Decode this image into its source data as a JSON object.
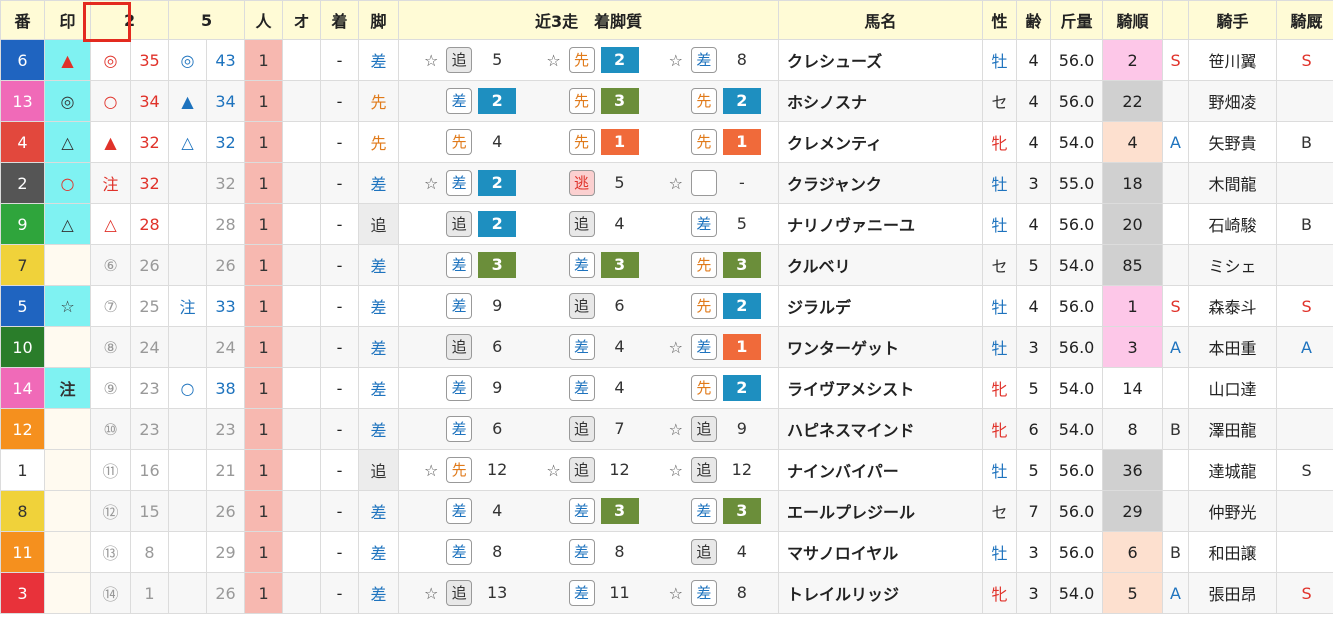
{
  "header": {
    "ban": "番",
    "in": "印",
    "c2": "2",
    "c5": "5",
    "ninki": "人",
    "o": "オ",
    "chaku": "着",
    "kyaku": "脚",
    "kin3": "近3走　着脚質",
    "bamei": "馬名",
    "sei": "性",
    "rei": "齢",
    "kinryo": "斤量",
    "kijun": "騎順",
    "kishu": "騎手",
    "kyusha": "騎厩"
  },
  "colors": {
    "waku": {
      "1": "#ffffff",
      "2": "#555555",
      "3": "#e8323a",
      "4": "#e2483d",
      "5": "#1f64c0",
      "6": "#1f64c0",
      "7": "#f0d23a",
      "8": "#f0d23a",
      "9": "#2fa53c",
      "10": "#2a7d2a",
      "11": "#f5901e",
      "12": "#f5901e",
      "13": "#f06ab8",
      "14": "#f06ab8"
    }
  },
  "rows": [
    {
      "num": "6",
      "numColor": "#1f64c0",
      "mark": "▲",
      "markClass": "mk-red",
      "markEmpty": false,
      "r2m": "◎",
      "r2mc": "red",
      "r2": "35",
      "r2c": "red",
      "r5m": "◎",
      "r5mc": "blue",
      "r5": "43",
      "r5c": "blue",
      "ninki": "1",
      "o": "",
      "chaku": "-",
      "kyaku": "差",
      "kyakuClass": "kyaku-sa",
      "races": [
        {
          "star": "☆",
          "tag": "追",
          "tagc": "tsui",
          "rk": "5",
          "rkc": "n"
        },
        {
          "star": "☆",
          "tag": "先",
          "tagc": "sen",
          "rk": "2",
          "rkc": "b"
        },
        {
          "star": "☆",
          "tag": "差",
          "tagc": "sa",
          "rk": "8",
          "rkc": "n"
        }
      ],
      "name": "クレシューズ",
      "sex": "牡",
      "sexClass": "sex-m",
      "age": "4",
      "kinryo": "56.0",
      "kijun": "2",
      "kijunClass": "kijun-1",
      "rank": "S",
      "rankc": "red",
      "jockey": "笹川翼",
      "stable": "S",
      "stablec": "red"
    },
    {
      "num": "13",
      "numColor": "#f06ab8",
      "mark": "◎",
      "markClass": "mk-dark",
      "markEmpty": false,
      "r2m": "○",
      "r2mc": "red",
      "r2": "34",
      "r2c": "red",
      "r5m": "▲",
      "r5mc": "blue",
      "r5": "34",
      "r5c": "blue",
      "ninki": "1",
      "o": "",
      "chaku": "-",
      "kyaku": "先",
      "kyakuClass": "kyaku-sen",
      "races": [
        {
          "star": "",
          "tag": "差",
          "tagc": "sa",
          "rk": "2",
          "rkc": "b"
        },
        {
          "star": "",
          "tag": "先",
          "tagc": "sen",
          "rk": "3",
          "rkc": "g"
        },
        {
          "star": "",
          "tag": "先",
          "tagc": "sen",
          "rk": "2",
          "rkc": "b"
        }
      ],
      "name": "ホシノスナ",
      "sex": "セ",
      "sexClass": "sex-g",
      "age": "4",
      "kinryo": "56.0",
      "kijun": "22",
      "kijunClass": "kijun-3",
      "rank": "",
      "rankc": "red",
      "jockey": "野畑凌",
      "stable": "",
      "stablec": "red"
    },
    {
      "num": "4",
      "numColor": "#e2483d",
      "mark": "△",
      "markClass": "mk-dark",
      "markEmpty": false,
      "r2m": "▲",
      "r2mc": "red",
      "r2": "32",
      "r2c": "red",
      "r5m": "△",
      "r5mc": "blue",
      "r5": "32",
      "r5c": "blue",
      "ninki": "1",
      "o": "",
      "chaku": "-",
      "kyaku": "先",
      "kyakuClass": "kyaku-sen",
      "races": [
        {
          "star": "",
          "tag": "先",
          "tagc": "sen",
          "rk": "4",
          "rkc": "n"
        },
        {
          "star": "",
          "tag": "先",
          "tagc": "sen",
          "rk": "1",
          "rkc": "r"
        },
        {
          "star": "",
          "tag": "先",
          "tagc": "sen",
          "rk": "1",
          "rkc": "r"
        }
      ],
      "name": "クレメンティ",
      "sex": "牝",
      "sexClass": "sex-f",
      "age": "4",
      "kinryo": "54.0",
      "kijun": "4",
      "kijunClass": "kijun-2",
      "rank": "A",
      "rankc": "blue",
      "jockey": "矢野貴",
      "stable": "B",
      "stablec": "dark"
    },
    {
      "num": "2",
      "numColor": "#555555",
      "mark": "○",
      "markClass": "mk-red",
      "markEmpty": false,
      "r2m": "注",
      "r2mc": "red",
      "r2": "32",
      "r2c": "red",
      "r5m": "",
      "r5mc": "blue",
      "r5": "32",
      "r5c": "gray",
      "ninki": "1",
      "o": "",
      "chaku": "-",
      "kyaku": "差",
      "kyakuClass": "kyaku-sa",
      "races": [
        {
          "star": "☆",
          "tag": "差",
          "tagc": "sa",
          "rk": "2",
          "rkc": "b"
        },
        {
          "star": "",
          "tag": "逃",
          "tagc": "nige",
          "rk": "5",
          "rkc": "n"
        },
        {
          "star": "☆",
          "tag": "",
          "tagc": "blank",
          "rk": "-",
          "rkc": "n"
        }
      ],
      "name": "クラジャンク",
      "sex": "牡",
      "sexClass": "sex-m",
      "age": "3",
      "kinryo": "55.0",
      "kijun": "18",
      "kijunClass": "kijun-3",
      "rank": "",
      "rankc": "red",
      "jockey": "木間龍",
      "stable": "",
      "stablec": "red"
    },
    {
      "num": "9",
      "numColor": "#2fa53c",
      "mark": "△",
      "markClass": "mk-dark",
      "markEmpty": false,
      "r2m": "△",
      "r2mc": "red",
      "r2": "28",
      "r2c": "red",
      "r5m": "",
      "r5mc": "blue",
      "r5": "28",
      "r5c": "gray",
      "ninki": "1",
      "o": "",
      "chaku": "-",
      "kyaku": "追",
      "kyakuClass": "kyaku-tsui",
      "races": [
        {
          "star": "",
          "tag": "追",
          "tagc": "tsui",
          "rk": "2",
          "rkc": "b"
        },
        {
          "star": "",
          "tag": "追",
          "tagc": "tsui",
          "rk": "4",
          "rkc": "n"
        },
        {
          "star": "",
          "tag": "差",
          "tagc": "sa",
          "rk": "5",
          "rkc": "n"
        }
      ],
      "name": "ナリノヴァニーユ",
      "sex": "牡",
      "sexClass": "sex-m",
      "age": "4",
      "kinryo": "56.0",
      "kijun": "20",
      "kijunClass": "kijun-3",
      "rank": "",
      "rankc": "red",
      "jockey": "石崎駿",
      "stable": "B",
      "stablec": "dark"
    },
    {
      "num": "7",
      "numColor": "#f0d23a",
      "mark": "",
      "markClass": "mk-dark",
      "markEmpty": true,
      "r2m": "⑥",
      "r2mc": "gray",
      "r2": "26",
      "r2c": "gray",
      "r5m": "",
      "r5mc": "blue",
      "r5": "26",
      "r5c": "gray",
      "ninki": "1",
      "o": "",
      "chaku": "-",
      "kyaku": "差",
      "kyakuClass": "kyaku-sa",
      "races": [
        {
          "star": "",
          "tag": "差",
          "tagc": "sa",
          "rk": "3",
          "rkc": "g"
        },
        {
          "star": "",
          "tag": "差",
          "tagc": "sa",
          "rk": "3",
          "rkc": "g"
        },
        {
          "star": "",
          "tag": "先",
          "tagc": "sen",
          "rk": "3",
          "rkc": "g"
        }
      ],
      "name": "クルベリ",
      "sex": "セ",
      "sexClass": "sex-g",
      "age": "5",
      "kinryo": "54.0",
      "kijun": "85",
      "kijunClass": "kijun-3",
      "rank": "",
      "rankc": "red",
      "jockey": "ミシェ",
      "stable": "",
      "stablec": "red"
    },
    {
      "num": "5",
      "numColor": "#1f64c0",
      "mark": "☆",
      "markClass": "mk-dark",
      "markEmpty": false,
      "r2m": "⑦",
      "r2mc": "gray",
      "r2": "25",
      "r2c": "gray",
      "r5m": "注",
      "r5mc": "blue",
      "r5": "33",
      "r5c": "blue",
      "ninki": "1",
      "o": "",
      "chaku": "-",
      "kyaku": "差",
      "kyakuClass": "kyaku-sa",
      "races": [
        {
          "star": "",
          "tag": "差",
          "tagc": "sa",
          "rk": "9",
          "rkc": "n"
        },
        {
          "star": "",
          "tag": "追",
          "tagc": "tsui",
          "rk": "6",
          "rkc": "n"
        },
        {
          "star": "",
          "tag": "先",
          "tagc": "sen",
          "rk": "2",
          "rkc": "b"
        }
      ],
      "name": "ジラルデ",
      "sex": "牡",
      "sexClass": "sex-m",
      "age": "4",
      "kinryo": "56.0",
      "kijun": "1",
      "kijunClass": "kijun-1",
      "rank": "S",
      "rankc": "red",
      "jockey": "森泰斗",
      "stable": "S",
      "stablec": "red"
    },
    {
      "num": "10",
      "numColor": "#2a7d2a",
      "mark": "",
      "markClass": "mk-dark",
      "markEmpty": true,
      "r2m": "⑧",
      "r2mc": "gray",
      "r2": "24",
      "r2c": "gray",
      "r5m": "",
      "r5mc": "blue",
      "r5": "24",
      "r5c": "gray",
      "ninki": "1",
      "o": "",
      "chaku": "-",
      "kyaku": "差",
      "kyakuClass": "kyaku-sa",
      "races": [
        {
          "star": "",
          "tag": "追",
          "tagc": "tsui",
          "rk": "6",
          "rkc": "n"
        },
        {
          "star": "",
          "tag": "差",
          "tagc": "sa",
          "rk": "4",
          "rkc": "n"
        },
        {
          "star": "☆",
          "tag": "差",
          "tagc": "sa",
          "rk": "1",
          "rkc": "r"
        }
      ],
      "name": "ワンターゲット",
      "sex": "牡",
      "sexClass": "sex-m",
      "age": "3",
      "kinryo": "56.0",
      "kijun": "3",
      "kijunClass": "kijun-1",
      "rank": "A",
      "rankc": "blue",
      "jockey": "本田重",
      "stable": "A",
      "stablec": "blue"
    },
    {
      "num": "14",
      "numColor": "#f06ab8",
      "mark": "注",
      "markClass": "mk-dark",
      "markEmpty": false,
      "r2m": "⑨",
      "r2mc": "gray",
      "r2": "23",
      "r2c": "gray",
      "r5m": "○",
      "r5mc": "blue",
      "r5": "38",
      "r5c": "blue",
      "ninki": "1",
      "o": "",
      "chaku": "-",
      "kyaku": "差",
      "kyakuClass": "kyaku-sa",
      "races": [
        {
          "star": "",
          "tag": "差",
          "tagc": "sa",
          "rk": "9",
          "rkc": "n"
        },
        {
          "star": "",
          "tag": "差",
          "tagc": "sa",
          "rk": "4",
          "rkc": "n"
        },
        {
          "star": "",
          "tag": "先",
          "tagc": "sen",
          "rk": "2",
          "rkc": "b"
        }
      ],
      "name": "ライヴアメシスト",
      "sex": "牝",
      "sexClass": "sex-f",
      "age": "5",
      "kinryo": "54.0",
      "kijun": "14",
      "kijunClass": "kijun-0",
      "rank": "",
      "rankc": "red",
      "jockey": "山口達",
      "stable": "",
      "stablec": "red"
    },
    {
      "num": "12",
      "numColor": "#f5901e",
      "mark": "",
      "markClass": "mk-dark",
      "markEmpty": true,
      "r2m": "⑩",
      "r2mc": "gray",
      "r2": "23",
      "r2c": "gray",
      "r5m": "",
      "r5mc": "blue",
      "r5": "23",
      "r5c": "gray",
      "ninki": "1",
      "o": "",
      "chaku": "-",
      "kyaku": "差",
      "kyakuClass": "kyaku-sa",
      "races": [
        {
          "star": "",
          "tag": "差",
          "tagc": "sa",
          "rk": "6",
          "rkc": "n"
        },
        {
          "star": "",
          "tag": "追",
          "tagc": "tsui",
          "rk": "7",
          "rkc": "n"
        },
        {
          "star": "☆",
          "tag": "追",
          "tagc": "tsui",
          "rk": "9",
          "rkc": "n"
        }
      ],
      "name": "ハピネスマインド",
      "sex": "牝",
      "sexClass": "sex-f",
      "age": "6",
      "kinryo": "54.0",
      "kijun": "8",
      "kijunClass": "kijun-0",
      "rank": "B",
      "rankc": "dark",
      "jockey": "澤田龍",
      "stable": "",
      "stablec": "red"
    },
    {
      "num": "1",
      "numColor": "#ffffff",
      "mark": "",
      "markClass": "mk-dark",
      "markEmpty": true,
      "r2m": "⑪",
      "r2mc": "gray",
      "r2": "16",
      "r2c": "gray",
      "r5m": "",
      "r5mc": "blue",
      "r5": "21",
      "r5c": "gray",
      "ninki": "1",
      "o": "",
      "chaku": "-",
      "kyaku": "追",
      "kyakuClass": "kyaku-tsui",
      "races": [
        {
          "star": "☆",
          "tag": "先",
          "tagc": "sen",
          "rk": "12",
          "rkc": "n"
        },
        {
          "star": "☆",
          "tag": "追",
          "tagc": "tsui",
          "rk": "12",
          "rkc": "n"
        },
        {
          "star": "☆",
          "tag": "追",
          "tagc": "tsui",
          "rk": "12",
          "rkc": "n"
        }
      ],
      "name": "ナインバイパー",
      "sex": "牡",
      "sexClass": "sex-m",
      "age": "5",
      "kinryo": "56.0",
      "kijun": "36",
      "kijunClass": "kijun-3",
      "rank": "",
      "rankc": "red",
      "jockey": "達城龍",
      "stable": "S",
      "stablec": "dark"
    },
    {
      "num": "8",
      "numColor": "#f0d23a",
      "mark": "",
      "markClass": "mk-dark",
      "markEmpty": true,
      "r2m": "⑫",
      "r2mc": "gray",
      "r2": "15",
      "r2c": "gray",
      "r5m": "",
      "r5mc": "blue",
      "r5": "26",
      "r5c": "gray",
      "ninki": "1",
      "o": "",
      "chaku": "-",
      "kyaku": "差",
      "kyakuClass": "kyaku-sa",
      "races": [
        {
          "star": "",
          "tag": "差",
          "tagc": "sa",
          "rk": "4",
          "rkc": "n"
        },
        {
          "star": "",
          "tag": "差",
          "tagc": "sa",
          "rk": "3",
          "rkc": "g"
        },
        {
          "star": "",
          "tag": "差",
          "tagc": "sa",
          "rk": "3",
          "rkc": "g"
        }
      ],
      "name": "エールプレジール",
      "sex": "セ",
      "sexClass": "sex-g",
      "age": "7",
      "kinryo": "56.0",
      "kijun": "29",
      "kijunClass": "kijun-3",
      "rank": "",
      "rankc": "red",
      "jockey": "仲野光",
      "stable": "",
      "stablec": "red"
    },
    {
      "num": "11",
      "numColor": "#f5901e",
      "mark": "",
      "markClass": "mk-dark",
      "markEmpty": true,
      "r2m": "⑬",
      "r2mc": "gray",
      "r2": "8",
      "r2c": "gray",
      "r5m": "",
      "r5mc": "blue",
      "r5": "29",
      "r5c": "gray",
      "ninki": "1",
      "o": "",
      "chaku": "-",
      "kyaku": "差",
      "kyakuClass": "kyaku-sa",
      "races": [
        {
          "star": "",
          "tag": "差",
          "tagc": "sa",
          "rk": "8",
          "rkc": "n"
        },
        {
          "star": "",
          "tag": "差",
          "tagc": "sa",
          "rk": "8",
          "rkc": "n"
        },
        {
          "star": "",
          "tag": "追",
          "tagc": "tsui",
          "rk": "4",
          "rkc": "n"
        }
      ],
      "name": "マサノロイヤル",
      "sex": "牡",
      "sexClass": "sex-m",
      "age": "3",
      "kinryo": "56.0",
      "kijun": "6",
      "kijunClass": "kijun-2",
      "rank": "B",
      "rankc": "dark",
      "jockey": "和田譲",
      "stable": "",
      "stablec": "red"
    },
    {
      "num": "3",
      "numColor": "#e8323a",
      "mark": "",
      "markClass": "mk-dark",
      "markEmpty": true,
      "r2m": "⑭",
      "r2mc": "gray",
      "r2": "1",
      "r2c": "gray",
      "r5m": "",
      "r5mc": "blue",
      "r5": "26",
      "r5c": "gray",
      "ninki": "1",
      "o": "",
      "chaku": "-",
      "kyaku": "差",
      "kyakuClass": "kyaku-sa",
      "races": [
        {
          "star": "☆",
          "tag": "追",
          "tagc": "tsui",
          "rk": "13",
          "rkc": "n"
        },
        {
          "star": "",
          "tag": "差",
          "tagc": "sa",
          "rk": "11",
          "rkc": "n"
        },
        {
          "star": "☆",
          "tag": "差",
          "tagc": "sa",
          "rk": "8",
          "rkc": "n"
        }
      ],
      "name": "トレイルリッジ",
      "sex": "牝",
      "sexClass": "sex-f",
      "age": "3",
      "kinryo": "54.0",
      "kijun": "5",
      "kijunClass": "kijun-2",
      "rank": "A",
      "rankc": "blue",
      "jockey": "張田昂",
      "stable": "S",
      "stablec": "red"
    }
  ]
}
